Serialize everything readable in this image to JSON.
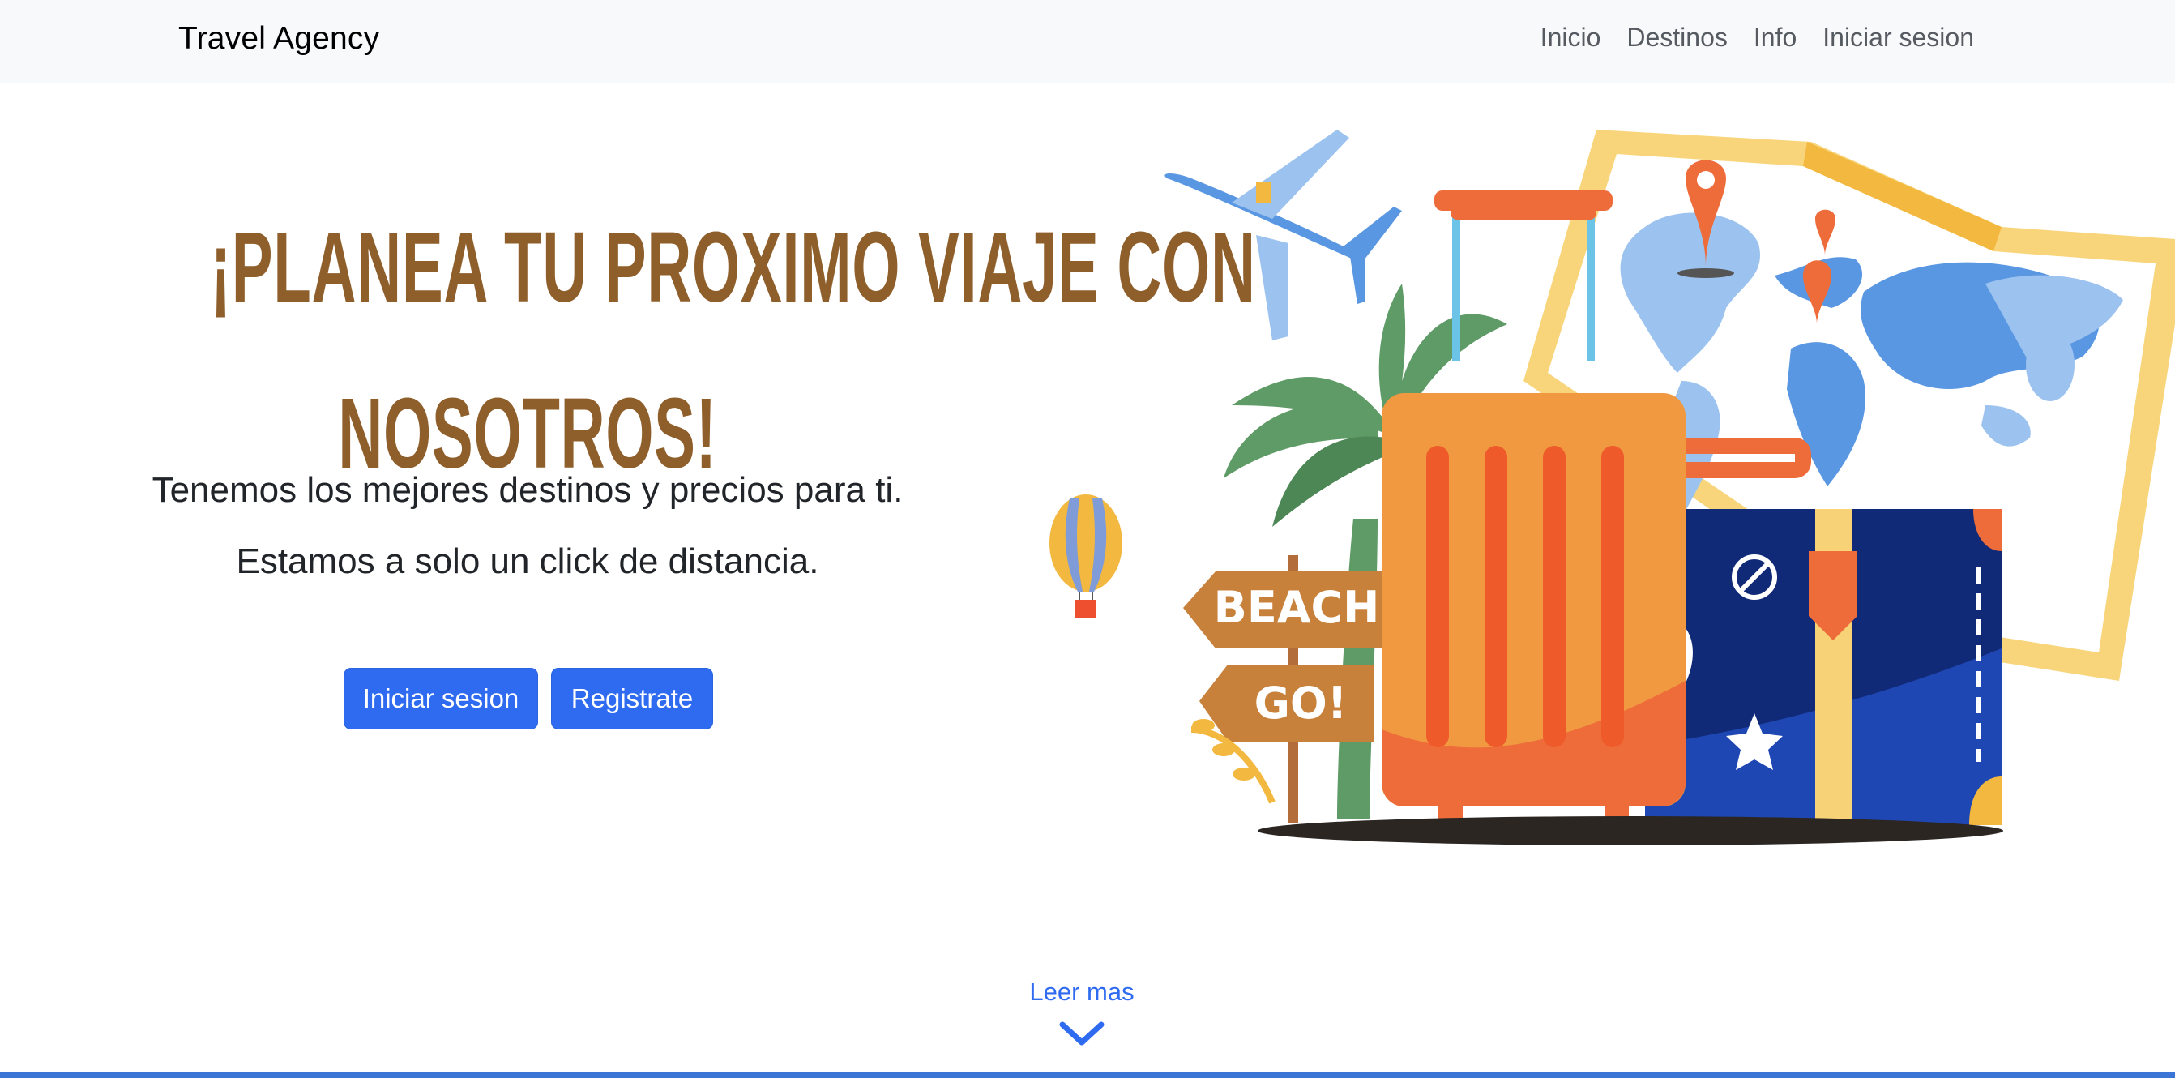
{
  "navbar": {
    "brand": "Travel Agency",
    "links": [
      "Inicio",
      "Destinos",
      "Info",
      "Iniciar sesion"
    ]
  },
  "hero": {
    "title_line1": "¡PLANEA TU PROXIMO VIAJE CON",
    "title_line2": "NOSOTROS!",
    "subtitle_line1": "Tenemos los mejores destinos y precios para ti.",
    "subtitle_line2": "Estamos a solo un click de distancia.",
    "login_button": "Iniciar sesion",
    "register_button": "Registrate"
  },
  "illustration": {
    "sign_top": "BEACH",
    "sign_bottom": "GO!"
  },
  "footer_cta": {
    "label": "Leer mas",
    "icon": "chevron-down-icon"
  },
  "colors": {
    "title": "#8f5f2b",
    "primary": "#2f6bf0",
    "navbar_bg": "#f8f9fa",
    "bottom_bar": "#3b76d6"
  }
}
